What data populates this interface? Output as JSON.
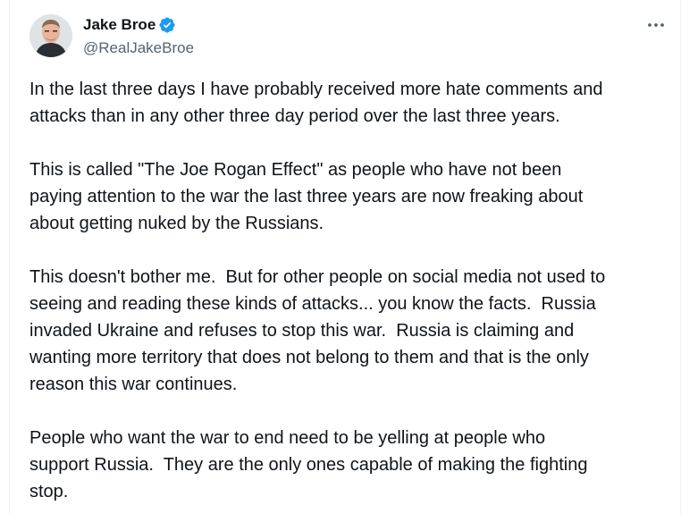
{
  "author": {
    "display_name": "Jake Broe",
    "handle": "@RealJakeBroe",
    "verified_icon": "verified-badge-icon",
    "avatar_icon": "profile-avatar"
  },
  "menu": {
    "more_icon": "more-options-icon"
  },
  "tweet": {
    "paragraphs": [
      "In the last three days I have probably received more hate comments and\nattacks than in any other three day period over the last three years.",
      "This is called \"The Joe Rogan Effect\" as people who have not been\npaying attention to the war the last three years are now freaking about\nabout getting nuked by the Russians.",
      "This doesn't bother me.  But for other people on social media not used to\nseeing and reading these kinds of attacks... you know the facts.  Russia\ninvaded Ukraine and refuses to stop this war.  Russia is claiming and\nwanting more territory that does not belong to them and that is the only\nreason this war continues.",
      "People who want the war to end need to be yelling at people who\nsupport Russia.  They are the only ones capable of making the fighting\nstop."
    ]
  },
  "colors": {
    "text": "#0f1419",
    "secondary": "#536471",
    "verified": "#1d9bf0",
    "border": "#eff3f4"
  }
}
